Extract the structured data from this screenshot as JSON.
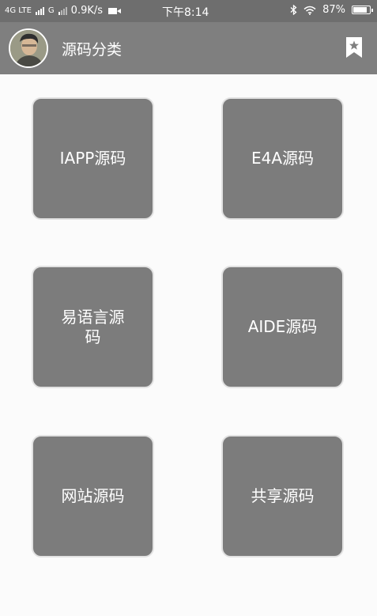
{
  "status_bar": {
    "network_left": "4G LTE",
    "network_right": "G",
    "speed": "0.9K/s",
    "time": "下午8:14",
    "battery": "87%",
    "battery_level": 0.87,
    "icons": [
      "signal-icon",
      "video-icon",
      "bluetooth-icon",
      "wifi-icon",
      "battery-icon"
    ]
  },
  "app_bar": {
    "title": "源码分类",
    "avatar_icon": "user-avatar",
    "action_icon": "bookmark-star-icon"
  },
  "categories": [
    {
      "label": "IAPP源码"
    },
    {
      "label": "E4A源码"
    },
    {
      "label": "易语言源码"
    },
    {
      "label": "AIDE源码"
    },
    {
      "label": "网站源码"
    },
    {
      "label": "共享源码"
    }
  ],
  "colors": {
    "status_bar_bg": "#6e6e6e",
    "app_bar_bg": "#7f7f7f",
    "tile_bg": "#7c7c7c",
    "tile_border": "#e2e2e2",
    "page_bg": "#fbfbfb",
    "text": "#ffffff"
  }
}
